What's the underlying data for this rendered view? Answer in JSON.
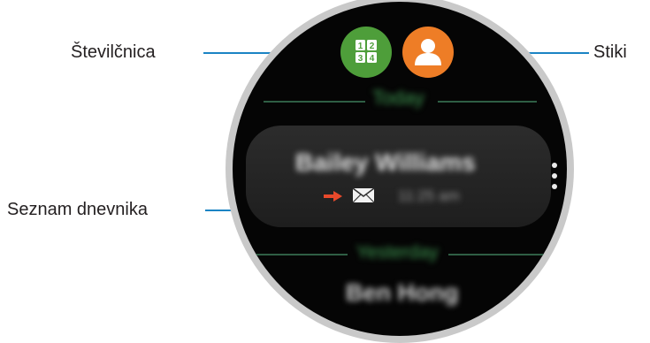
{
  "callouts": {
    "keypad": "Številčnica",
    "contacts": "Stiki",
    "log_list": "Seznam dnevnika"
  },
  "watch": {
    "section_today": "Today",
    "entry_name": "Bailey Williams",
    "entry_time": "11:25 am",
    "section_yesterday": "Yesterday",
    "next_entry_name": "Ben Hong",
    "keypad_digits": [
      "1",
      "2",
      "3",
      "4"
    ]
  },
  "colors": {
    "keypad_button": "#4e9e3a",
    "contacts_button": "#ee7d26",
    "callout_line": "#1b84c4",
    "arrow": "#e8492b"
  },
  "icons": {
    "keypad": "keypad-icon",
    "contacts": "contact-person-icon",
    "more": "more-options-icon",
    "call_type": "outgoing-arrow-icon",
    "message": "envelope-icon"
  }
}
